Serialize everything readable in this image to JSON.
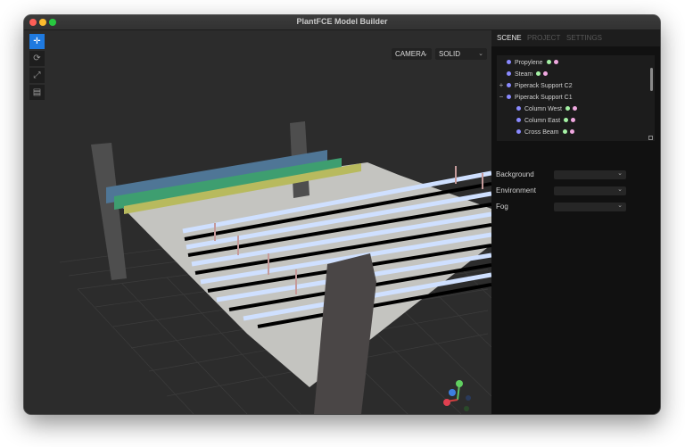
{
  "window": {
    "title": "PlantFCE Model Builder"
  },
  "viewport": {
    "camera_select": "CAMERA",
    "shading_select": "SOLID",
    "toolbar": [
      "move-icon",
      "rotate-icon",
      "scale-icon",
      "layers-icon"
    ]
  },
  "panel": {
    "tabs": [
      "SCENE",
      "PROJECT",
      "SETTINGS"
    ],
    "active_tab": "SCENE",
    "tree": [
      {
        "label": "Propylene",
        "expander": "",
        "level": 0
      },
      {
        "label": "Steam",
        "expander": "",
        "level": 0
      },
      {
        "label": "Piperack Support C2",
        "expander": "+",
        "level": 0
      },
      {
        "label": "Piperack Support C1",
        "expander": "−",
        "level": 0
      },
      {
        "label": "Column West",
        "expander": "",
        "level": 1
      },
      {
        "label": "Column East",
        "expander": "",
        "level": 1
      },
      {
        "label": "Cross Beam",
        "expander": "",
        "level": 1
      }
    ],
    "properties": {
      "background": {
        "label": "Background",
        "value": ""
      },
      "environment": {
        "label": "Environment",
        "value": ""
      },
      "fog": {
        "label": "Fog",
        "value": ""
      }
    }
  },
  "colors": {
    "accent": "#1f7ae0",
    "pipe_blue": "#4f7696",
    "pipe_green": "#3e9e70",
    "pipe_yellow": "#b8ba5e",
    "small_pipe": "#cfe0ff"
  }
}
